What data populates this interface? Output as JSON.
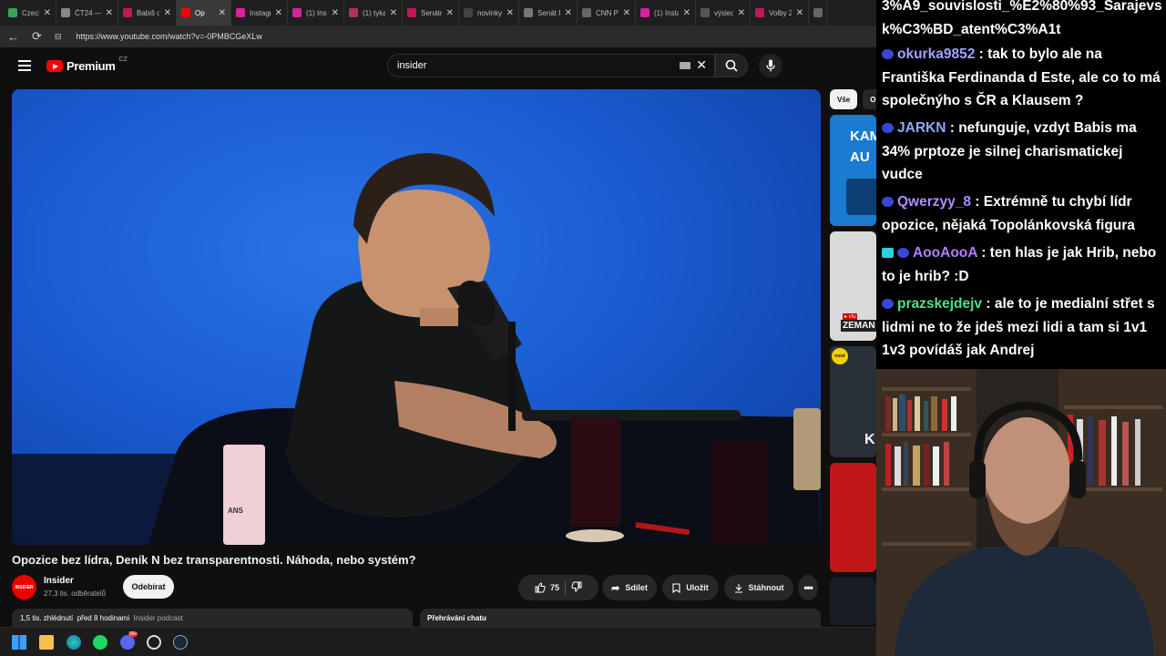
{
  "tabs": [
    {
      "label": "CzechC",
      "color": "#3aa35a"
    },
    {
      "label": "ČT24 —",
      "color": "#888888"
    },
    {
      "label": "Babiš o",
      "color": "#c2185b"
    },
    {
      "label": "Op",
      "color": "#ff0000",
      "active": true
    },
    {
      "label": "Instagra",
      "color": "#d6249f"
    },
    {
      "label": "(1) Insta",
      "color": "#d6249f"
    },
    {
      "label": "(1) tyka",
      "color": "#b03060"
    },
    {
      "label": "Senátní",
      "color": "#c2185b"
    },
    {
      "label": "novinky",
      "color": "#444444"
    },
    {
      "label": "Senát R",
      "color": "#777777"
    },
    {
      "label": "CNN Pr",
      "color": "#666666"
    },
    {
      "label": "(1) Insta",
      "color": "#d6249f"
    },
    {
      "label": "výsledk",
      "color": "#555555"
    },
    {
      "label": "Volby 2",
      "color": "#c2185b"
    },
    {
      "label": "V",
      "color": "#666666"
    }
  ],
  "address": {
    "url": "https://www.youtube.com/watch?v=-0PMBCGeXLw"
  },
  "header": {
    "logo_text": "Premium",
    "logo_country": "CZ",
    "search_value": "insider"
  },
  "video": {
    "title": "Opozice bez lídra, Deník N bez transparentnosti. Náhoda, nebo systém?",
    "can_label": "ANS"
  },
  "channel": {
    "avatar_text": "INSIDER",
    "name": "Insider",
    "subs": "27,3 tis. odběratelů",
    "subscribe_label": "Odebírat"
  },
  "actions": {
    "like_count": "75",
    "share_label": "Sdílet",
    "save_label": "Uložit",
    "download_label": "Stáhnout"
  },
  "description": {
    "views": "1,5 tis. zhlédnutí",
    "time": "před 8 hodinami",
    "tag": "Insider podcast"
  },
  "chat": {
    "replay_label": "Přehrávání chatu"
  },
  "sidebar": {
    "chips": [
      "Vše",
      "O"
    ],
    "thumbs": [
      {
        "text": "KAM AU",
        "bg": "#1a7bd0"
      },
      {
        "text": "ZEMAN",
        "bg": "#d9d9d9"
      },
      {
        "text": "K",
        "bg": "#2a3038"
      },
      {
        "text": "",
        "bg": "#c01818"
      }
    ],
    "thumb_badges": [
      "▸ vlo",
      "nové"
    ]
  },
  "overlay_chat": {
    "top_text": "3%A9_souvislosti_%E2%80%93_Sarajevsk%C3%BD_atent%C3%A1t",
    "messages": [
      {
        "user": "okurka9852",
        "color": "#9fa5ff",
        "text": "tak to bylo ale na Františka Ferdinanda d Este, ale co to má společnýho s ČR a Klausem ?",
        "badges": [
          "blue"
        ]
      },
      {
        "user": "JARKN",
        "color": "#8fa9ff",
        "text": "nefunguje, vzdyt Babis ma 34% prptoze je silnej charismatickej vudce",
        "badges": [
          "blue"
        ]
      },
      {
        "user": "Qwerzyy_8",
        "color": "#b28cff",
        "text": "Extrémně tu chybí lídr opozice, nějaká Topolánkovská figura",
        "badges": [
          "blue"
        ]
      },
      {
        "user": "AooAooA",
        "color": "#b57dff",
        "text": "ten hlas je jak Hrib, nebo to je hrib? :D",
        "badges": [
          "cyan",
          "blue"
        ]
      },
      {
        "user": "prazskejdejv",
        "color": "#4fe08a",
        "text": "ale to je medialní střet s lidmi ne to že jdeš mezi lidi a tam si 1v1 1v3 povídáš jak Andrej",
        "badges": [
          "blue"
        ]
      }
    ]
  },
  "taskbar": {
    "icons": [
      "windows-icon",
      "folder-icon",
      "edge-icon",
      "spotify-icon",
      "discord-icon",
      "chatgpt-icon",
      "steam-icon"
    ],
    "discord_badge": "99+"
  }
}
